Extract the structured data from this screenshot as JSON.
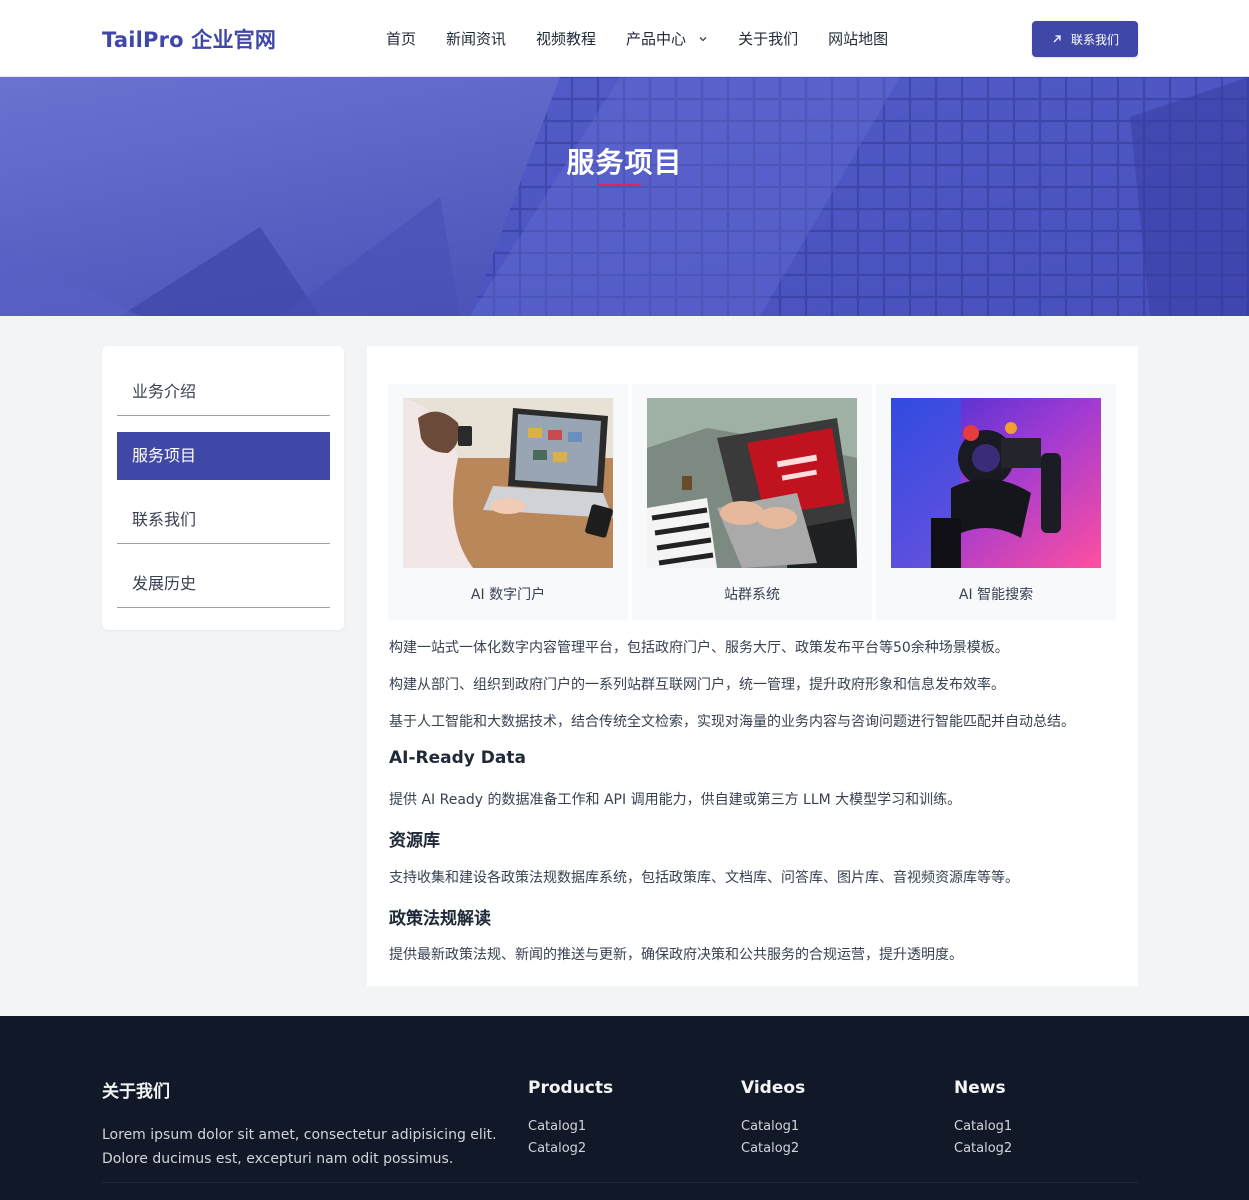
{
  "header": {
    "logo": "TailPro 企业官网",
    "nav": [
      "首页",
      "新闻资讯",
      "视频教程",
      "产品中心",
      "关于我们",
      "网站地图"
    ],
    "contact_button": "联系我们"
  },
  "banner": {
    "title": "服务项目"
  },
  "sidebar": {
    "items": [
      "业务介绍",
      "服务项目",
      "联系我们",
      "发展历史"
    ],
    "active": "服务项目"
  },
  "cards": [
    {
      "caption": "AI 数字门户"
    },
    {
      "caption": "站群系统"
    },
    {
      "caption": "AI 智能搜索"
    }
  ],
  "content": {
    "p1": "构建一站式一体化数字内容管理平台，包括政府门户、服务大厅、政策发布平台等50余种场景模板。",
    "p2": "构建从部门、组织到政府门户的一系列站群互联网门户，统一管理，提升政府形象和信息发布效率。",
    "p3": "基于人工智能和大数据技术，结合传统全文检索，实现对海量的业务内容与咨询问题进行智能匹配并自动总结。",
    "h1": "AI-Ready Data",
    "p4": "提供 AI Ready 的数据准备工作和 API 调用能力，供自建或第三方 LLM 大模型学习和训练。",
    "h2": "资源库",
    "p5": "支持收集和建设各政策法规数据库系统，包括政策库、文档库、问答库、图片库、音视频资源库等等。",
    "h3": "政策法规解读",
    "p6": "提供最新政策法规、新闻的推送与更新，确保政府决策和公共服务的合规运营，提升透明度。"
  },
  "footer": {
    "about_title": "关于我们",
    "about_line1": "Lorem ipsum dolor sit amet, consectetur adipisicing elit.",
    "about_line2": "Dolore ducimus est, excepturi nam odit possimus.",
    "columns": [
      {
        "title": "Products",
        "links": [
          "Catalog1",
          "Catalog2"
        ]
      },
      {
        "title": "Videos",
        "links": [
          "Catalog1",
          "Catalog2"
        ]
      },
      {
        "title": "News",
        "links": [
          "Catalog1",
          "Catalog2"
        ]
      }
    ]
  },
  "colors": {
    "accent": "#3f48a6",
    "banner_underline": "#e11d74",
    "footer_bg": "#111827"
  },
  "icons": {
    "nav_dropdown": "chevron-down-icon",
    "contact": "arrow-up-right-icon"
  }
}
